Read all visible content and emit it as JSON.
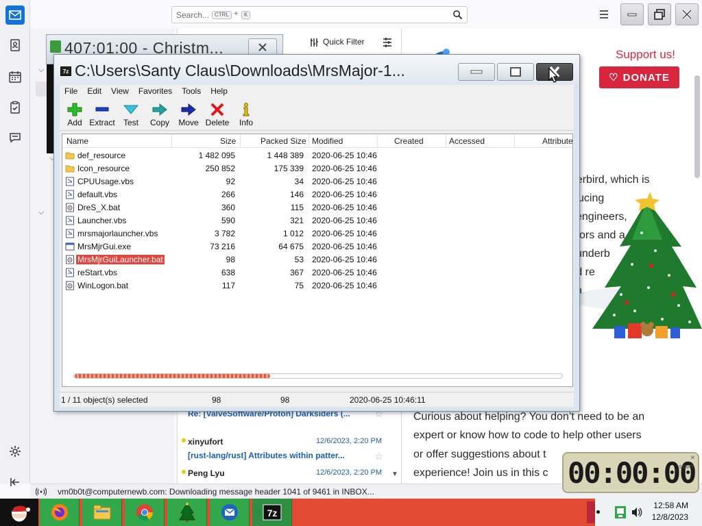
{
  "thunderbird": {
    "search": {
      "placeholder": "Search...",
      "key1": "CTRL",
      "plus": "+",
      "key2": "K"
    },
    "quick_filter": "Quick Filter",
    "messages": [
      {
        "from": "xinyufort",
        "date": "12/6/2023, 2:20 PM",
        "subject": "[rust-lang/rust] Attributes within patter..."
      },
      {
        "from": "Peng Lyu",
        "date": "12/6/2023, 2:20 PM",
        "subject": ""
      }
    ],
    "partial_message_subject": "Re: [ValveSoftware/Proton] Darksiders (...",
    "message_pane": {
      "support": "Support us!",
      "donate": "DONATE",
      "lines": [
        "nderbird, which is",
        "ucing",
        "engineers,",
        "ors and a",
        "underb",
        "rd re",
        "n.",
        "Curious about helping? You don’t need to be an",
        "expert or know how to code to help other users",
        "or offer suggestions about t",
        "experience! Join us in this c"
      ]
    },
    "status": "vm0b0t@computernewb.com: Downloading message header 1041 of 9461 in INBOX..."
  },
  "xmas_window": {
    "title": "407:01:00 - Christm..."
  },
  "sevenzip": {
    "title": "C:\\Users\\Santy Claus\\Downloads\\MrsMajor-1...",
    "menu": [
      "File",
      "Edit",
      "View",
      "Favorites",
      "Tools",
      "Help"
    ],
    "toolbar": [
      "Add",
      "Extract",
      "Test",
      "Copy",
      "Move",
      "Delete",
      "Info"
    ],
    "columns": [
      "Name",
      "Size",
      "Packed Size",
      "Modified",
      "Created",
      "Accessed",
      "Attribute"
    ],
    "files": [
      {
        "name": "def_resource",
        "type": "folder",
        "size": "1 482 095",
        "packed": "1 448 389",
        "modified": "2020-06-25 10:46",
        "attr": true
      },
      {
        "name": "Icon_resource",
        "type": "folder",
        "size": "250 852",
        "packed": "175 339",
        "modified": "2020-06-25 10:46",
        "attr": true
      },
      {
        "name": "CPUUsage.vbs",
        "type": "script",
        "size": "92",
        "packed": "34",
        "modified": "2020-06-25 10:46"
      },
      {
        "name": "default.vbs",
        "type": "script",
        "size": "266",
        "packed": "146",
        "modified": "2020-06-25 10:46"
      },
      {
        "name": "DreS_X.bat",
        "type": "batch",
        "size": "360",
        "packed": "115",
        "modified": "2020-06-25 10:46"
      },
      {
        "name": "Launcher.vbs",
        "type": "script",
        "size": "590",
        "packed": "321",
        "modified": "2020-06-25 10:46"
      },
      {
        "name": "mrsmajorlauncher.vbs",
        "type": "script",
        "size": "3 782",
        "packed": "1 012",
        "modified": "2020-06-25 10:46"
      },
      {
        "name": "MrsMjrGui.exe",
        "type": "exe",
        "size": "73 216",
        "packed": "64 675",
        "modified": "2020-06-25 10:46"
      },
      {
        "name": "MrsMjrGuiLauncher.bat",
        "type": "batch",
        "size": "98",
        "packed": "53",
        "modified": "2020-06-25 10:46",
        "selected": true
      },
      {
        "name": "reStart.vbs",
        "type": "script",
        "size": "638",
        "packed": "367",
        "modified": "2020-06-25 10:46"
      },
      {
        "name": "WinLogon.bat",
        "type": "batch",
        "size": "117",
        "packed": "75",
        "modified": "2020-06-25 10:46"
      }
    ],
    "hscroll_position": 0.4,
    "status": {
      "selection": "1 / 11 object(s) selected",
      "size": "98",
      "packed": "98",
      "modified": "2020-06-25 10:46:11"
    }
  },
  "clock_widget": {
    "digits": "00:00:00",
    "label": "START"
  },
  "taskbar": {
    "apps": [
      "firefox-icon",
      "file-explorer-icon",
      "chrome-icon",
      "christmas-tree-icon",
      "thunderbird-icon",
      "7zip-icon"
    ],
    "time": "12:58 AM",
    "date": "12/8/2023"
  },
  "colors": {
    "selection": "#e0483e",
    "taskbar": "#e34a34",
    "taskbar_app": "#32a84a",
    "donate": "#d7263d",
    "tb_accent": "#1373d9"
  }
}
